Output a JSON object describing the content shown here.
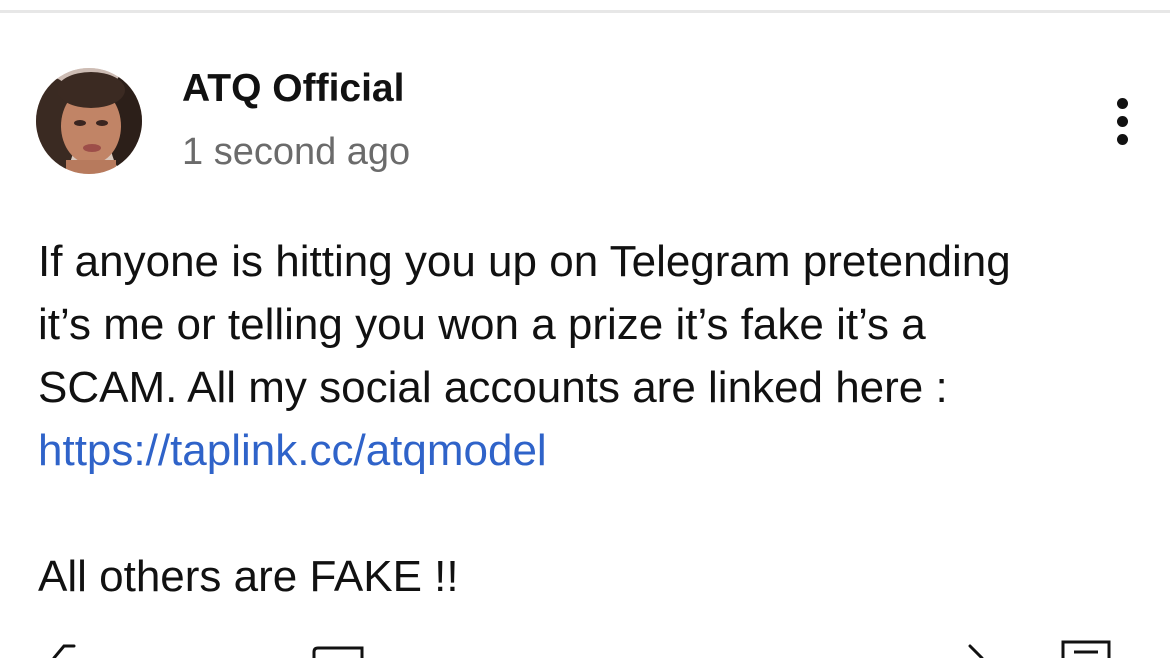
{
  "post": {
    "author": {
      "name": "ATQ Official",
      "avatar_icon": "profile-photo"
    },
    "timestamp": "1 second ago",
    "menu_icon": "more-vertical-icon",
    "body": {
      "lines": [
        "If anyone is hitting you up on Telegram pretending",
        "it’s me or telling you won a prize it’s fake it’s a",
        "SCAM. All my social accounts are linked here :"
      ],
      "link": "https://taplink.cc/atqmodel",
      "closing": "All others are FAKE !!"
    }
  },
  "action_bar": {
    "icons": [
      "like-icon",
      "comment-icon",
      "share-icon",
      "save-icon"
    ]
  },
  "colors": {
    "link": "#2f63c9",
    "text": "#111111",
    "secondary_text": "#6b6b6b",
    "divider": "#e7e7e7"
  }
}
